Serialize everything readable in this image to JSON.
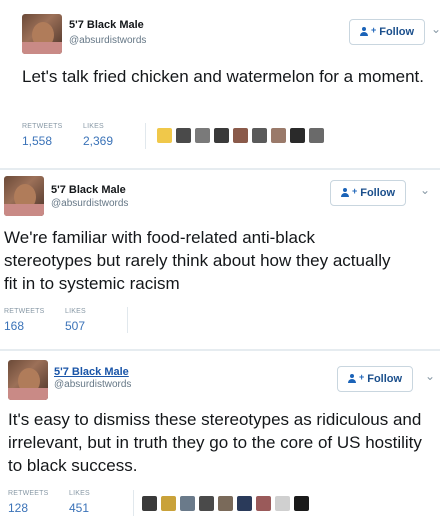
{
  "tweets": [
    {
      "author_name": "5'7 Black Male",
      "author_handle": "@absurdistwords",
      "follow_label": "Follow",
      "text": "Let's talk fried chicken and watermelon for a moment.",
      "retweets_label": "RETWEETS",
      "retweets": "1,558",
      "likes_label": "LIKES",
      "likes": "2,369",
      "likers": [
        "#f0c84a",
        "#4a4a4a",
        "#7a7a7a",
        "#3a3a3a",
        "#8a5a4a",
        "#5a5a5a",
        "#9a7a6a",
        "#2a2a2a",
        "#6a6a6a"
      ]
    },
    {
      "author_name": "5'7 Black Male",
      "author_handle": "@absurdistwords",
      "follow_label": "Follow",
      "text": "We're familiar with food-related anti-black stereotypes but rarely think about how they actually fit in to systemic racism",
      "retweets_label": "RETWEETS",
      "retweets": "168",
      "likes_label": "LIKES",
      "likes": "507"
    },
    {
      "author_name": "5'7 Black Male",
      "author_handle": "@absurdistwords",
      "follow_label": "Follow",
      "text": "It's easy to dismiss these stereotypes as ridiculous and irrelevant, but in truth they go to the core of US hostility to black success.",
      "retweets_label": "RETWEETS",
      "retweets": "128",
      "likes_label": "LIKES",
      "likes": "451",
      "likers": [
        "#3a3a3a",
        "#c9a23a",
        "#6a7a8a",
        "#4a4a4a",
        "#7a6a5a",
        "#2a3a5a",
        "#9a5a5a",
        "#d0d0d0",
        "#1a1a1a"
      ]
    }
  ]
}
